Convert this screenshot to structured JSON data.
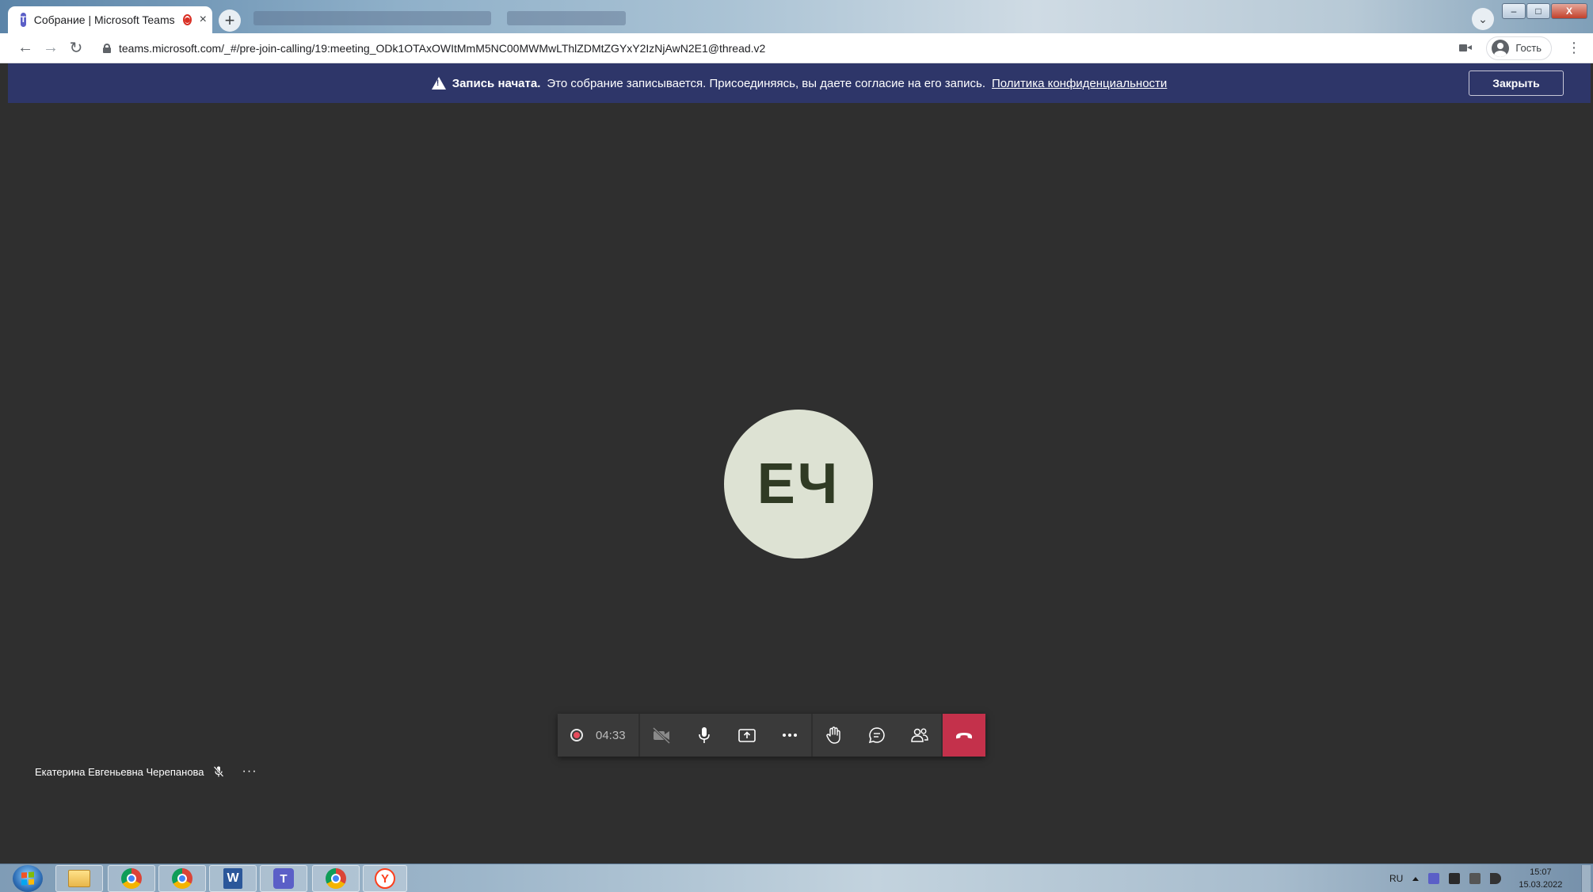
{
  "browser": {
    "tab_title": "Собрание | Microsoft Teams",
    "tab_close": "×",
    "new_tab": "+",
    "url": "teams.microsoft.com/_#/pre-join-calling/19:meeting_ODk1OTAxOWItMmM5NC00MWMwLThlZDMtZGYxY2IzNjAwN2E1@thread.v2",
    "profile_label": "Гость",
    "menu": "⋮",
    "win_minimize": "–",
    "win_maximize": "□",
    "win_close": "X"
  },
  "banner": {
    "bold": "Запись начата.",
    "text": "Это собрание записывается. Присоединяясь, вы даете согласие на его запись.",
    "link": "Политика конфиденциальности",
    "close_label": "Закрыть"
  },
  "participant": {
    "initials": "ЕЧ",
    "name": "Екатерина Евгеньевна Черепанова",
    "more": "···"
  },
  "call": {
    "timer": "04:33",
    "colors": {
      "hangup": "#c4314b",
      "banner": "#2e3669",
      "avatar_bg": "#dde2d3"
    }
  },
  "taskbar": {
    "lang": "RU",
    "time": "15:07",
    "date": "15.03.2022",
    "apps": [
      "start-button",
      "explorer",
      "chrome",
      "chrome-profile",
      "word",
      "teams",
      "chrome",
      "yandex-browser"
    ]
  }
}
